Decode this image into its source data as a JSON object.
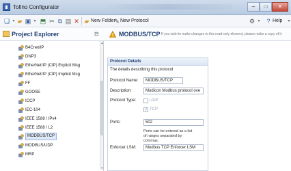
{
  "window": {
    "title": "Tofino Configurator",
    "minimize_glyph": "–",
    "maximize_glyph": "□",
    "close_glyph": "✕"
  },
  "toolbar": {
    "new_folder_label": "New Folder",
    "new_protocol_label": "New Protocol",
    "help_label": "Help",
    "tools_glyph": "⚙",
    "dropdown_glyph": "▾"
  },
  "explorer": {
    "title": "Project Explorer",
    "collapse_glyph": "⊟",
    "items": [
      {
        "label": "B4Cnet/IP",
        "icon": "protocol-icon"
      },
      {
        "label": "DNP3",
        "icon": "protocol-icon"
      },
      {
        "label": "EtherNet/IP (CIP) Explicit Msg",
        "icon": "protocol-icon"
      },
      {
        "label": "EtherNet/IP (CIP) Implicit Msg",
        "icon": "protocol-icon"
      },
      {
        "label": "FF",
        "icon": "protocol-icon"
      },
      {
        "label": "GOOSE",
        "icon": "protocol-icon"
      },
      {
        "label": "ICCP",
        "icon": "protocol-icon"
      },
      {
        "label": "IEC-104",
        "icon": "protocol-icon"
      },
      {
        "label": "IEEE 1588 / IPv4",
        "icon": "protocol-icon"
      },
      {
        "label": "IEEE 1588 / L2",
        "icon": "protocol-icon"
      },
      {
        "label": "MODBUS/TCP",
        "icon": "protocol-icon",
        "selected": true
      },
      {
        "label": "MODBUS/UDP",
        "icon": "protocol-icon"
      },
      {
        "label": "MRP",
        "icon": "protocol-icon"
      }
    ]
  },
  "editor": {
    "title": "MODBUS/TCP",
    "note": "If you wish to make changes to this read-only element, please make a copy of it.",
    "section_title": "Protocol Details",
    "section_description": "The details describing this protocol",
    "fields": {
      "name_label": "Protocol Name:",
      "name_value": "MODBUS/TCP",
      "description_label": "Description:",
      "description_value": "Modicon Modbus protocol ove",
      "type_label": "Protocol Type:",
      "udp_label": "UDP",
      "tcp_label": "TCP",
      "udp_checked": false,
      "tcp_checked": true,
      "check_glyph": "✓",
      "ports_label": "Ports:",
      "ports_value": "502",
      "ports_note": "Ports can be entered as a list of ranges separated by commas.",
      "enforcer_label": "Enforcer LSM:",
      "enforcer_value": "Modbus TCP Enforcer LSM"
    }
  },
  "colors": {
    "accent": "#1f3f72",
    "selection": "#dfe9f8",
    "warning": "#e9a200"
  }
}
